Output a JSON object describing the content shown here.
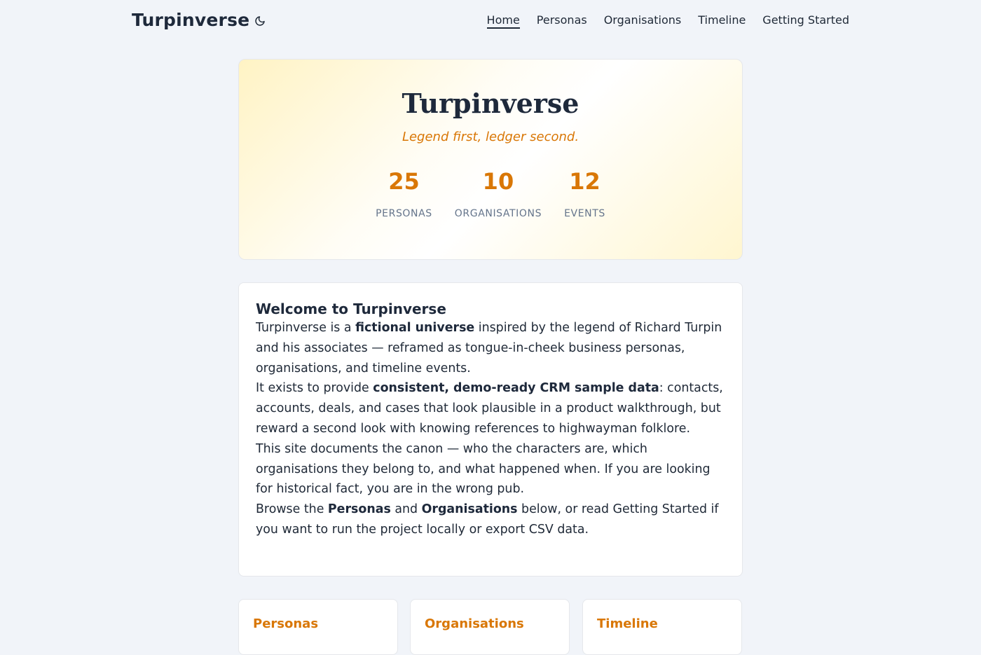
{
  "header": {
    "brand": "Turpinverse",
    "theme_icon": "moon-icon",
    "nav": [
      {
        "label": "Home",
        "active": true
      },
      {
        "label": "Personas"
      },
      {
        "label": "Organisations"
      },
      {
        "label": "Timeline"
      },
      {
        "label": "Getting Started"
      }
    ]
  },
  "hero": {
    "title": "Turpinverse",
    "tagline": "Legend first, ledger second.",
    "stats": [
      {
        "value": "25",
        "label": "PERSONAS"
      },
      {
        "value": "10",
        "label": "ORGANISATIONS"
      },
      {
        "value": "12",
        "label": "EVENTS"
      }
    ]
  },
  "welcome": {
    "heading": "Welcome to Turpinverse",
    "p1": {
      "a": "Turpinverse is a ",
      "b": "fictional universe",
      "c": " inspired by the legend of Richard Turpin and his associates — reframed as tongue-in-cheek business personas, organisations, and timeline events."
    },
    "p2": {
      "a": "It exists to provide ",
      "b": "consistent, demo-ready CRM sample data",
      "c": ": contacts, accounts, deals, and cases that look plausible in a product walkthrough, but reward a second look with knowing references to highwayman folklore."
    },
    "p3": "This site documents the canon — who the characters are, which organisations they belong to, and what happened when. If you are looking for historical fact, you are in the wrong pub.",
    "p4": {
      "a": "Browse the ",
      "b": "Personas",
      "c": " and ",
      "d": "Organisations",
      "e": " below, or read Getting Started if you want to run the project locally or export CSV data."
    }
  },
  "cards": [
    {
      "title": "Personas"
    },
    {
      "title": "Organisations"
    },
    {
      "title": "Timeline"
    }
  ],
  "colors": {
    "accent": "#d97706",
    "background": "#f1f4f9",
    "text": "#1f2937"
  }
}
